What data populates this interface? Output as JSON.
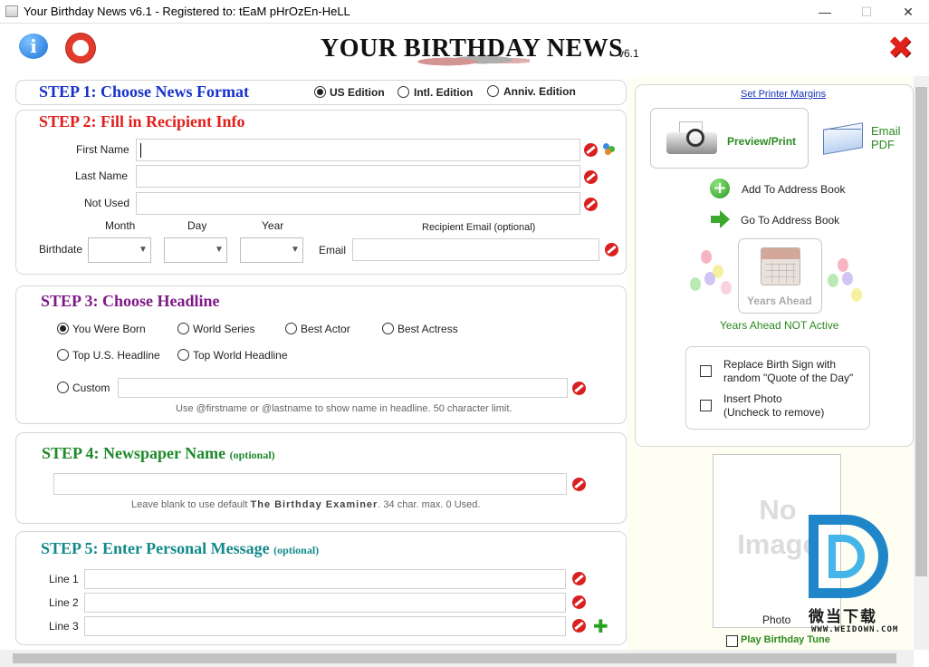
{
  "window": {
    "title": "Your Birthday News v6.1 - Registered to: tEaM pHrOzEn-HeLL",
    "minimize": "—",
    "maximize": "☐",
    "close": "✕"
  },
  "header": {
    "logo": "YOUR BIRTHDAY NEWS",
    "version": "v6.1",
    "info_icon": "i"
  },
  "step1": {
    "title": "STEP 1: Choose News Format",
    "color": "#1733c9",
    "options": [
      {
        "label": "US Edition",
        "selected": true
      },
      {
        "label": "Intl. Edition",
        "selected": false
      },
      {
        "label": "Anniv. Edition",
        "selected": false
      }
    ]
  },
  "step2": {
    "title": "STEP 2: Fill in Recipient Info",
    "color": "#e0201c",
    "first_name_label": "First Name",
    "last_name_label": "Last Name",
    "not_used_label": "Not Used",
    "first_name": "",
    "last_name": "",
    "not_used": "",
    "month_label": "Month",
    "day_label": "Day",
    "year_label": "Year",
    "birthdate_label": "Birthdate",
    "email_header": "Recipient Email (optional)",
    "email_label": "Email",
    "email": ""
  },
  "step3": {
    "title": "STEP 3: Choose Headline",
    "color": "#7e1a86",
    "options": [
      {
        "label": "You Were Born",
        "selected": true
      },
      {
        "label": "World Series",
        "selected": false
      },
      {
        "label": "Best Actor",
        "selected": false
      },
      {
        "label": "Best Actress",
        "selected": false
      },
      {
        "label": "Top U.S. Headline",
        "selected": false
      },
      {
        "label": "Top World Headline",
        "selected": false
      },
      {
        "label": "Custom",
        "selected": false
      }
    ],
    "custom_value": "",
    "hint": "Use @firstname or @lastname to show name in headline. 50 character limit."
  },
  "step4": {
    "title": "STEP 4: Newspaper Name",
    "optional": "(optional)",
    "color": "#1e8a2b",
    "value": "",
    "hint_before": "Leave blank to use default",
    "hint_bold": "The Birthday Examiner",
    "hint_after": ". 34 char. max. 0 Used."
  },
  "step5": {
    "title": "STEP 5: Enter Personal Message",
    "optional": "(optional)",
    "color": "#138a8a",
    "lines": [
      {
        "label": "Line 1",
        "value": ""
      },
      {
        "label": "Line 2",
        "value": ""
      },
      {
        "label": "Line 3",
        "value": ""
      }
    ]
  },
  "side": {
    "printer_margins": "Set Printer Margins",
    "preview_print": "Preview/Print",
    "email_pdf_line1": "Email",
    "email_pdf_line2": "PDF",
    "add_address": "Add To Address Book",
    "go_address": "Go To Address Book",
    "years_ahead": "Years Ahead",
    "years_ahead_status": "Years Ahead NOT Active",
    "replace_sign_line1": "Replace Birth Sign with",
    "replace_sign_line2": "random \"Quote of the Day\"",
    "insert_photo_line1": "Insert Photo",
    "insert_photo_line2": "(Uncheck to remove)",
    "no_image_line1": "No",
    "no_image_line2": "Image",
    "photo_label": "Photo",
    "play_tune": "Play Birthday Tune"
  },
  "watermark": {
    "cn": "微当下载",
    "url": "WWW.WEIDOWN.COM"
  }
}
